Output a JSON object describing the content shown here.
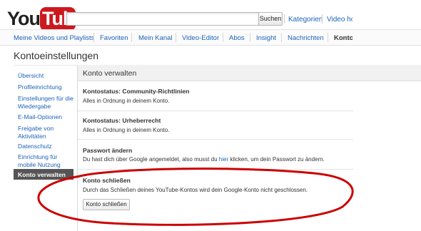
{
  "header": {
    "logo_you": "You",
    "logo_tube": "Tube",
    "search_button": "Suchen",
    "links": [
      "Kategorien",
      "Video hoc"
    ]
  },
  "nav": {
    "items": [
      "Meine Videos und Playlists",
      "Favoriten",
      "Mein Kanal",
      "Video-Editor",
      "Abos",
      "Insight",
      "Nachrichten",
      "Konto"
    ],
    "active": "Konto"
  },
  "page_title": "Kontoeinstellungen",
  "sidebar": {
    "items": [
      "Übersicht",
      "Profileinrichtung",
      "Einstellungen für die Wiedergabe",
      "E-Mail-Optionen",
      "Freigabe von Aktivitäten",
      "Datenschutz",
      "Einrichtung für mobile Nutzung"
    ],
    "active": "Konto verwalten"
  },
  "panel": {
    "title": "Konto verwalten",
    "sections": [
      {
        "title": "Kontostatus: Community-Richtlinien",
        "text": "Alles in Ordnung in deinem Konto."
      },
      {
        "title": "Kontostatus: Urheberrecht",
        "text": "Alles in Ordnung in deinem Konto."
      },
      {
        "title": "Passwort ändern",
        "text_before": "Du hast dich über Google angemeldet, also musst du ",
        "link": "hier",
        "text_after": " klicken, um dein Passwort zu ändern."
      },
      {
        "title": "Konto schließen",
        "text": "Durch das Schließen deines YouTube-Kontos wird dein Google-Konto nicht geschlossen.",
        "button": "Konto schließen"
      }
    ]
  },
  "colors": {
    "link": "#1c62b9",
    "annotation_oval": "#cc0000",
    "logo_red": "#cc181e",
    "active_sidebar": "#555555"
  }
}
